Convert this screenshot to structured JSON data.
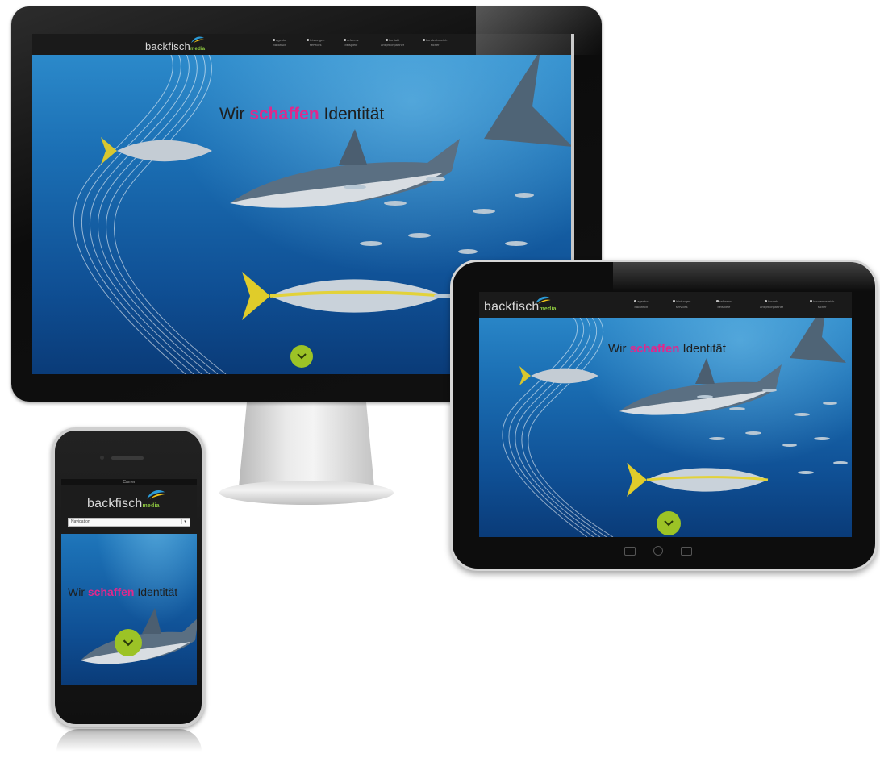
{
  "logo": {
    "brand": "backfisch",
    "suffix": "media"
  },
  "headline": {
    "pre": "Wir",
    "accent": "schaffen",
    "post": "Identität"
  },
  "nav_items": [
    {
      "label_1": "agentur",
      "label_2": "backfisch"
    },
    {
      "label_1": "leistungen",
      "label_2": "services"
    },
    {
      "label_1": "referenz",
      "label_2": "beispiele"
    },
    {
      "label_1": "kontakt",
      "label_2": "ansprechpartner"
    },
    {
      "label_1": "kundenbereich",
      "label_2": "sicher"
    }
  ],
  "phone": {
    "carrier": "Carrier",
    "nav_select_placeholder": "Navigation"
  },
  "colors": {
    "accent_pink": "#e0288c",
    "scroll_button_green": "#9cc326",
    "logo_green": "#8cc63f",
    "navbar_bg": "#1a1a1a"
  },
  "icons": [
    "chevron-down-icon",
    "logo-swoosh-icon",
    "home-key-icon"
  ]
}
